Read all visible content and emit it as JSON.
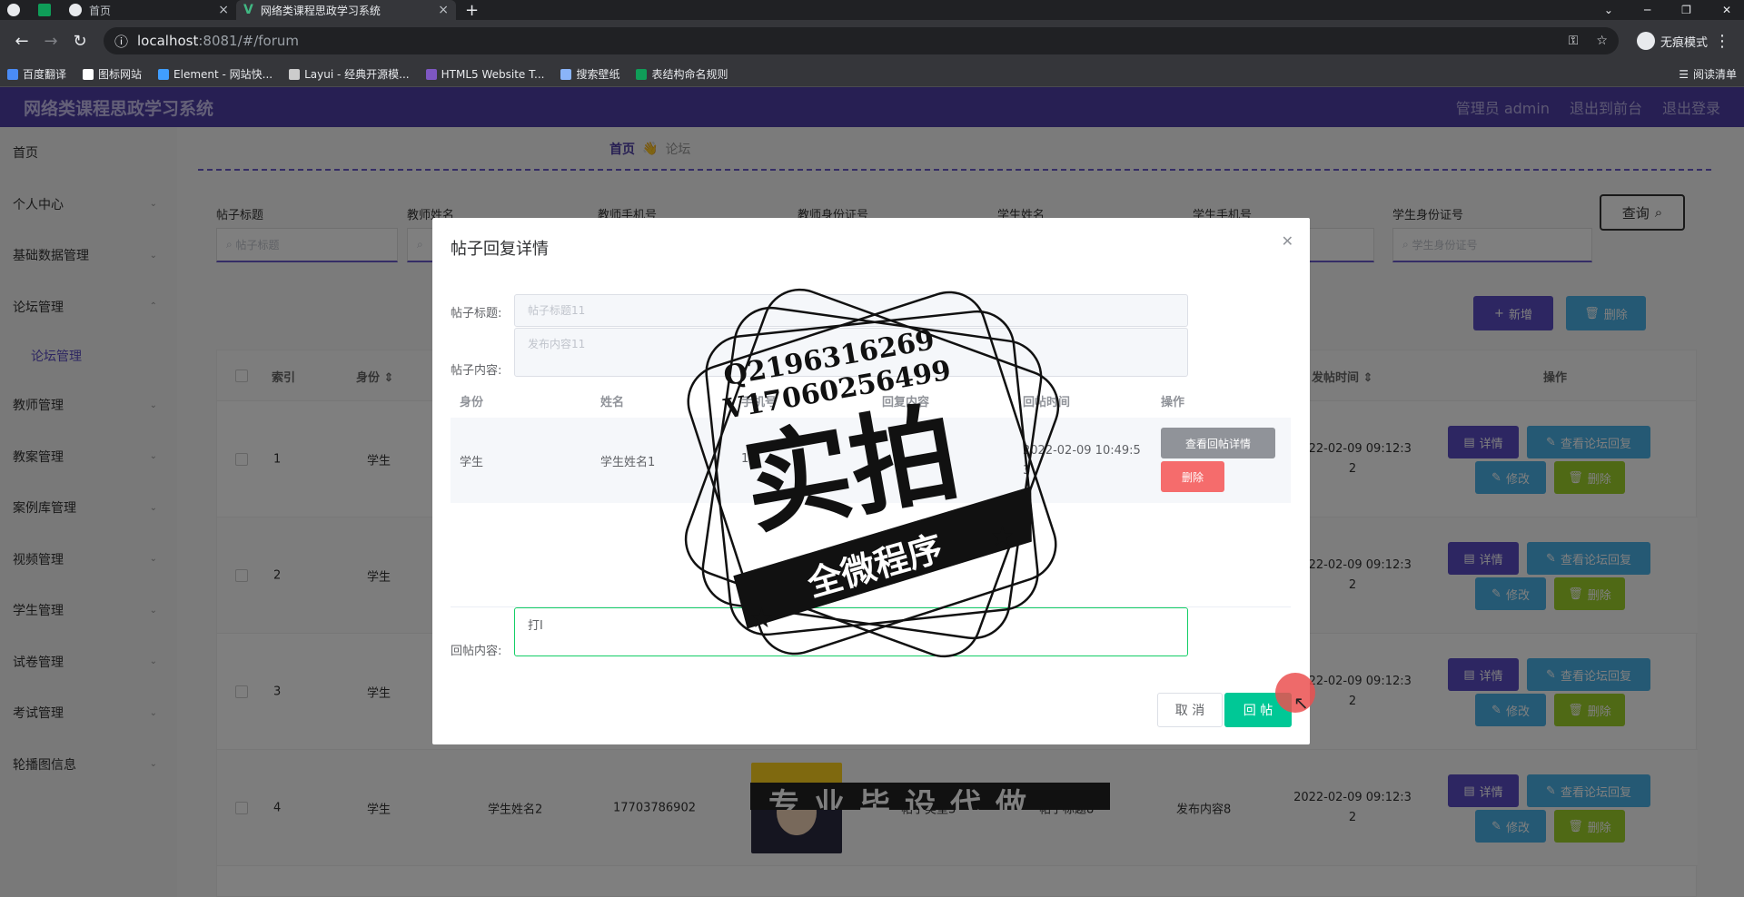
{
  "browser": {
    "tabs": [
      {
        "label": ""
      },
      {
        "label": ""
      },
      {
        "label": "首页"
      },
      {
        "label": "网络类课程思政学习系统"
      }
    ],
    "url_host": "localhost",
    "url_path": ":8081/#/forum",
    "incognito": "无痕模式",
    "bookmarks": [
      "百度翻译",
      "图标网站",
      "Element - 网站快...",
      "Layui - 经典开源模...",
      "HTML5 Website T...",
      "搜索壁纸",
      "表结构命名规则"
    ],
    "reading_list": "阅读清单"
  },
  "header": {
    "title": "网络类课程思政学习系统",
    "admin": "管理员 admin",
    "front": "退出到前台",
    "logout": "退出登录"
  },
  "sidebar": {
    "items": [
      "首页",
      "个人中心",
      "基础数据管理",
      "论坛管理",
      "论坛管理",
      "教师管理",
      "教案管理",
      "案例库管理",
      "视频管理",
      "学生管理",
      "试卷管理",
      "考试管理",
      "轮播图信息"
    ]
  },
  "breadcrumb": {
    "home": "首页",
    "current": "论坛"
  },
  "search": {
    "fields": [
      {
        "label": "帖子标题",
        "placeholder": "帖子标题"
      },
      {
        "label": "教师姓名",
        "placeholder": ""
      },
      {
        "label": "教师手机号",
        "placeholder": ""
      },
      {
        "label": "教师身份证号",
        "placeholder": ""
      },
      {
        "label": "学生姓名",
        "placeholder": ""
      },
      {
        "label": "学生手机号",
        "placeholder": ""
      },
      {
        "label": "学生身份证号",
        "placeholder": "学生身份证号"
      }
    ],
    "query": "查询"
  },
  "actions": {
    "add": "新增",
    "delete": "删除"
  },
  "table": {
    "headers": {
      "index": "索引",
      "identity": "身份",
      "post_time": "发帖时间",
      "ops": "操作"
    },
    "rows": [
      {
        "index": "1",
        "identity": "学生",
        "name": "",
        "phone": "",
        "type": "",
        "title": "",
        "content": "",
        "time": "2022-02-09 09:12:3",
        "time2": "2"
      },
      {
        "index": "2",
        "identity": "学生",
        "name": "",
        "phone": "",
        "type": "",
        "title": "",
        "content": "",
        "time": "2022-02-09 09:12:3",
        "time2": "2"
      },
      {
        "index": "3",
        "identity": "学生",
        "name": "",
        "phone": "",
        "type": "",
        "title": "",
        "content": "",
        "time": "2022-02-09 09:12:3",
        "time2": "2"
      },
      {
        "index": "4",
        "identity": "学生",
        "name": "学生姓名2",
        "phone": "17703786902",
        "type": "帖子类型3",
        "title": "帖子标题8",
        "content": "发布内容8",
        "time": "2022-02-09 09:12:3",
        "time2": "2"
      }
    ],
    "btn_detail": "详情",
    "btn_view": "查看论坛回复",
    "btn_edit": "修改",
    "btn_delete": "删除"
  },
  "dialog": {
    "title": "帖子回复详情",
    "post_title_label": "帖子标题:",
    "post_title_value": "帖子标题11",
    "post_content_label": "帖子内容:",
    "post_content_value": "发布内容11",
    "columns": [
      "身份",
      "姓名",
      "手机号",
      "回复内容",
      "回帖时间",
      "操作"
    ],
    "row": {
      "identity": "学生",
      "name": "学生姓名1",
      "phone": "1",
      "reply": "",
      "time": "2022-02-09 10:49:5",
      "time2": "3"
    },
    "btn_view": "查看回帖详情",
    "btn_delete": "删除",
    "reply_label": "回帖内容:",
    "reply_value": "打I",
    "cancel": "取 消",
    "submit": "回 帖"
  },
  "watermark": {
    "line1": "Q2196316269",
    "line2": "V17060256499",
    "big": "实拍",
    "ribbon": "全微程序"
  },
  "banner_text": "专业毕设代做"
}
